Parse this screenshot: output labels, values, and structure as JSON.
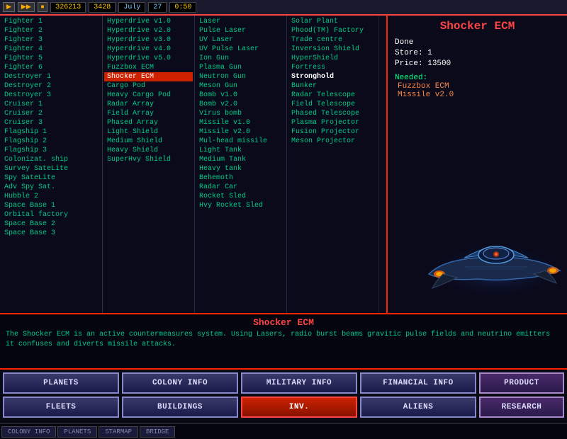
{
  "topbar": {
    "btn1": "▶",
    "btn2": "▶▶",
    "btn3": "⏹",
    "credits": "326213",
    "production": "3428",
    "month": "July",
    "day": "27",
    "time": "0:50"
  },
  "units": [
    {
      "id": 1,
      "label": "Fighter 1"
    },
    {
      "id": 2,
      "label": "Fighter 2"
    },
    {
      "id": 3,
      "label": "Fighter 3"
    },
    {
      "id": 4,
      "label": "Fighter 4"
    },
    {
      "id": 5,
      "label": "Fighter 5"
    },
    {
      "id": 6,
      "label": "Fighter 6"
    },
    {
      "id": 7,
      "label": "Destroyer 1"
    },
    {
      "id": 8,
      "label": "Destroyer 2"
    },
    {
      "id": 9,
      "label": "Destroyer 3"
    },
    {
      "id": 10,
      "label": "Cruiser 1"
    },
    {
      "id": 11,
      "label": "Cruiser 2"
    },
    {
      "id": 12,
      "label": "Cruiser 3"
    },
    {
      "id": 13,
      "label": "Flagship 1"
    },
    {
      "id": 14,
      "label": "Flagship 2"
    },
    {
      "id": 15,
      "label": "Flagship 3"
    },
    {
      "id": 16,
      "label": "Colonizat. ship"
    },
    {
      "id": 17,
      "label": "Survey SateLite"
    },
    {
      "id": 18,
      "label": "Spy SateLite"
    },
    {
      "id": 19,
      "label": "Adv Spy Sat."
    },
    {
      "id": 20,
      "label": "Hubble 2"
    },
    {
      "id": 21,
      "label": "Space Base 1"
    },
    {
      "id": 22,
      "label": "Orbital factory"
    },
    {
      "id": 23,
      "label": "Space Base 2"
    },
    {
      "id": 24,
      "label": "Space Base 3"
    }
  ],
  "tech_col1": [
    {
      "label": "Hyperdrive v1.0"
    },
    {
      "label": "Hyperdrive v2.0"
    },
    {
      "label": "Hyperdrive v3.0"
    },
    {
      "label": "Hyperdrive v4.0"
    },
    {
      "label": "Hyperdrive v5.0"
    },
    {
      "label": "Fuzzbox ECM"
    },
    {
      "label": "Shocker ECM",
      "selected": true
    },
    {
      "label": "Cargo Pod"
    },
    {
      "label": "Heavy Cargo Pod"
    },
    {
      "label": "Radar Array"
    },
    {
      "label": "Field Array"
    },
    {
      "label": "Phased Array"
    },
    {
      "label": "Light Shield"
    },
    {
      "label": "Medium Shield"
    },
    {
      "label": "Heavy Shield"
    },
    {
      "label": "SuperHvy Shield"
    }
  ],
  "tech_col2": [
    {
      "label": "Laser"
    },
    {
      "label": "Pulse Laser"
    },
    {
      "label": "UV Laser"
    },
    {
      "label": "UV Pulse Laser"
    },
    {
      "label": "Ion Gun"
    },
    {
      "label": "Plasma Gun"
    },
    {
      "label": "Neutron Gun"
    },
    {
      "label": "Meson Gun"
    },
    {
      "label": "Bomb v1.0"
    },
    {
      "label": "Bomb v2.0"
    },
    {
      "label": "Virus bomb"
    },
    {
      "label": "Missile v1.0"
    },
    {
      "label": "Missile v2.0"
    },
    {
      "label": "Mul-head missile"
    },
    {
      "label": "Light Tank"
    },
    {
      "label": "Medium Tank"
    },
    {
      "label": "Heavy tank"
    },
    {
      "label": "Behemoth"
    },
    {
      "label": "Radar Car"
    },
    {
      "label": "Rocket Sled"
    },
    {
      "label": "Hvy Rocket Sled"
    }
  ],
  "tech_col3": [
    {
      "label": "Solar Plant"
    },
    {
      "label": "Phood(TM) Factory"
    },
    {
      "label": "Trade centre"
    },
    {
      "label": "Inversion Shield"
    },
    {
      "label": "HyperShield"
    },
    {
      "label": "Fortress"
    },
    {
      "label": "Stronghold",
      "bold": true
    },
    {
      "label": "Bunker"
    },
    {
      "label": "Radar Telescope"
    },
    {
      "label": "Field Telescope"
    },
    {
      "label": "Phased Telescope"
    },
    {
      "label": "Plasma Projector"
    },
    {
      "label": "Fusion Projector"
    },
    {
      "label": "Meson Projector"
    }
  ],
  "info_panel": {
    "title": "Shocker ECM",
    "done_label": "Done",
    "store_label": "Store:",
    "store_value": "1",
    "price_label": "Price:",
    "price_value": "13500",
    "needed_label": "Needed:",
    "needed_items": [
      "Fuzzbox ECM",
      "Missile v2.0"
    ]
  },
  "description": {
    "title": "Shocker ECM",
    "text": "The Shocker ECM is an active countermeasures system. Using Lasers, radio burst beams gravitic pulse fields and neutrino emitters it confuses and diverts missile attacks."
  },
  "nav_buttons": {
    "row1": [
      {
        "label": "PLANETS",
        "active": false
      },
      {
        "label": "COLONY INFO",
        "active": false
      },
      {
        "label": "MILITARY INFO",
        "active": false
      },
      {
        "label": "FINANCIAL INFO",
        "active": false
      }
    ],
    "row2": [
      {
        "label": "FLEETS",
        "active": false
      },
      {
        "label": "BUILDINGS",
        "active": false
      },
      {
        "label": "INV.",
        "active": true
      },
      {
        "label": "ALIENS",
        "active": false
      }
    ],
    "right_row1": {
      "label": "PRODUCT"
    },
    "right_row2": {
      "label": "RESEARCH"
    }
  },
  "very_bottom": [
    {
      "label": "COLONY INFO"
    },
    {
      "label": "PLANETS"
    },
    {
      "label": "STARMAP"
    },
    {
      "label": "BRIDGE"
    }
  ]
}
